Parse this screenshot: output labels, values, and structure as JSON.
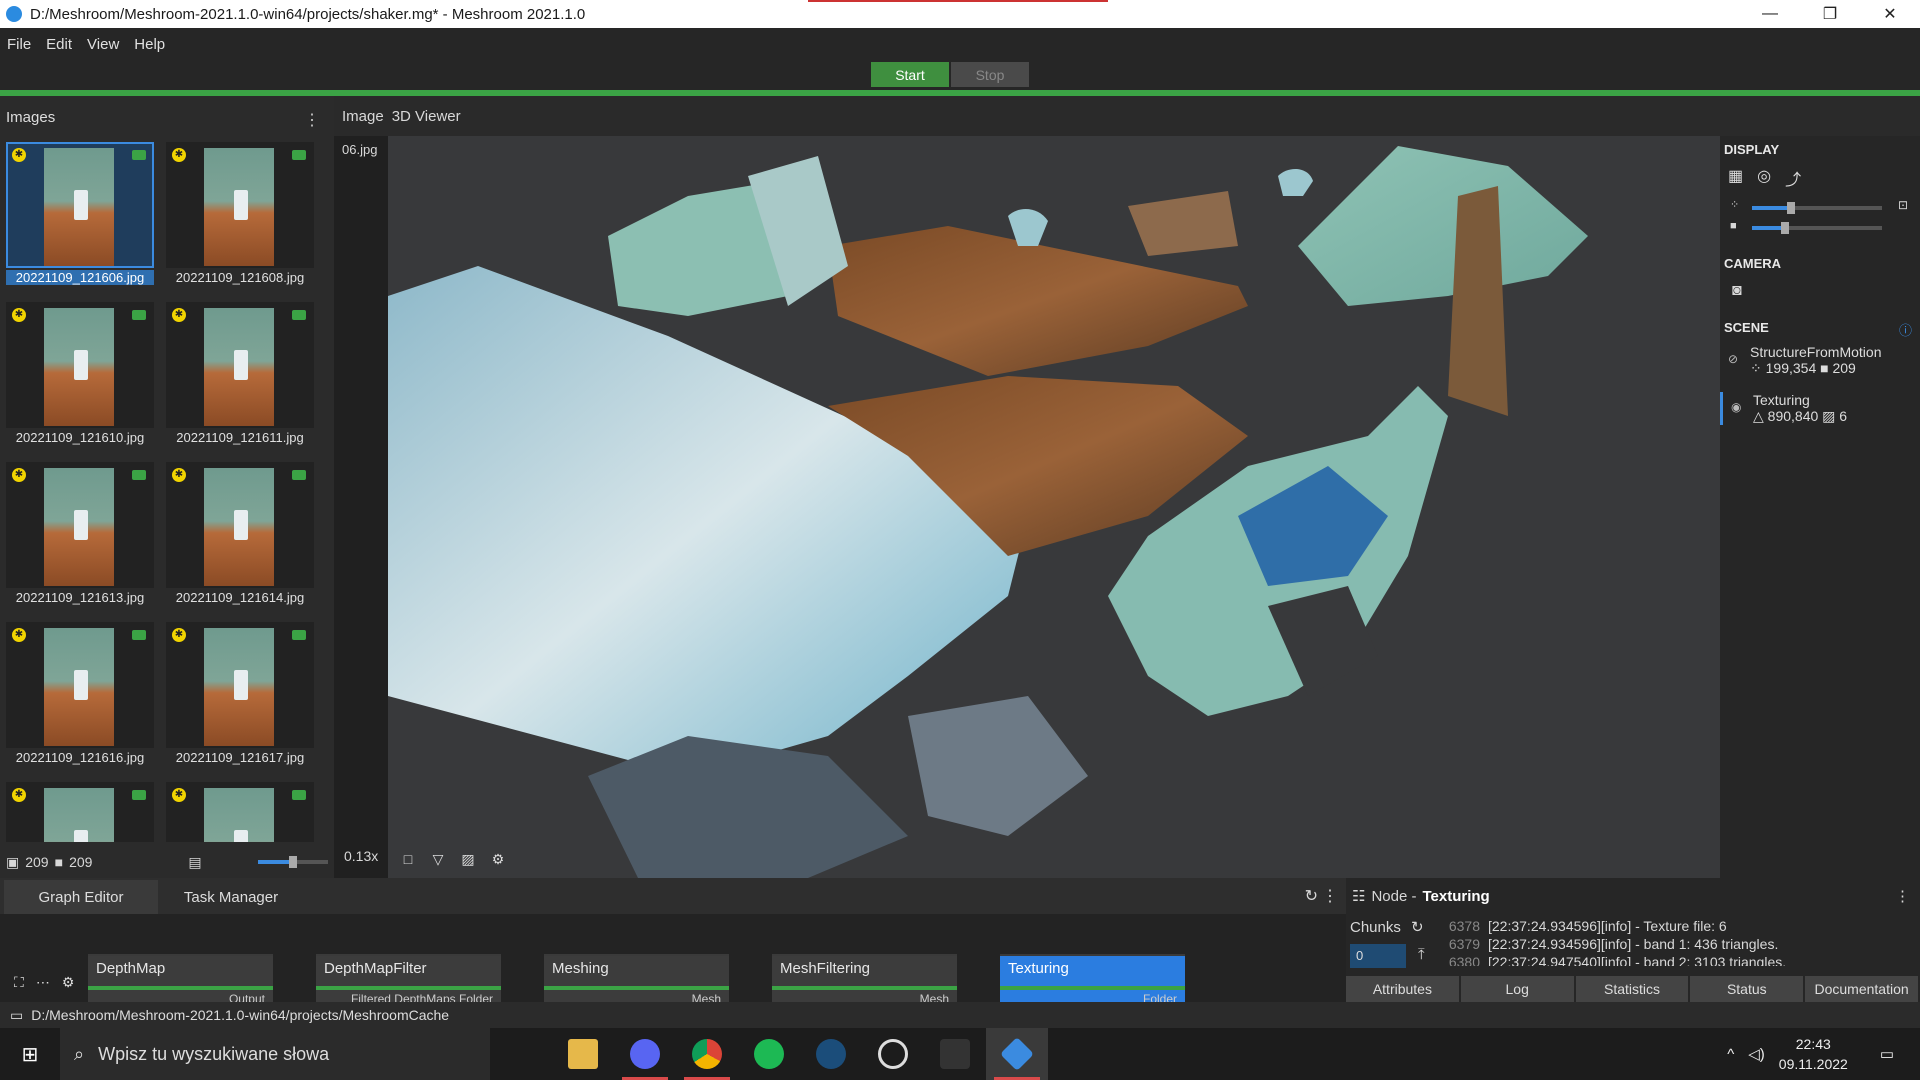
{
  "window": {
    "title": "D:/Meshroom/Meshroom-2021.1.0-win64/projects/shaker.mg* - Meshroom 2021.1.0",
    "minimize": "—",
    "maximize": "❐",
    "close": "✕"
  },
  "menu": [
    "File",
    "Edit",
    "View",
    "Help"
  ],
  "run": {
    "start": "Start",
    "stop": "Stop"
  },
  "images_panel": {
    "title": "Images",
    "kebab": "⋮",
    "thumbs": [
      {
        "name": "20221109_121606.jpg",
        "selected": true
      },
      {
        "name": "20221109_121608.jpg"
      },
      {
        "name": "20221109_121610.jpg"
      },
      {
        "name": "20221109_121611.jpg"
      },
      {
        "name": "20221109_121613.jpg"
      },
      {
        "name": "20221109_121614.jpg"
      },
      {
        "name": "20221109_121616.jpg"
      },
      {
        "name": "20221109_121617.jpg"
      },
      {
        "name": ""
      },
      {
        "name": ""
      }
    ],
    "image_count": "209",
    "camera_count": "209",
    "thumb_size_fraction": 0.5
  },
  "viewer": {
    "tabs": [
      "Image",
      "3D Viewer"
    ],
    "strip_filename": "06.jpg",
    "zoom": "0.13x"
  },
  "display": {
    "section": "DISPLAY",
    "point_size_fraction": 0.3,
    "camera_size_fraction": 0.25
  },
  "camera": {
    "section": "CAMERA"
  },
  "scene": {
    "section": "SCENE",
    "items": [
      {
        "name": "StructureFromMotion",
        "points": "199,354",
        "cameras": "209",
        "visible": false
      },
      {
        "name": "Texturing",
        "triangles": "890,840",
        "textures": "6",
        "visible": true
      }
    ]
  },
  "bottom": {
    "tabs": [
      "Graph Editor",
      "Task Manager"
    ],
    "nodes": [
      {
        "name": "DepthMap",
        "output": "Output"
      },
      {
        "name": "DepthMapFilter",
        "output": "Filtered DepthMaps Folder"
      },
      {
        "name": "Meshing",
        "output": "Mesh"
      },
      {
        "name": "MeshFiltering",
        "output": "Mesh"
      },
      {
        "name": "Texturing",
        "output": "Folder",
        "selected": true
      }
    ]
  },
  "node_panel": {
    "prefix": "Node - ",
    "node_name": "Texturing",
    "chunks_label": "Chunks",
    "chunk_value": "0",
    "log": [
      {
        "line": "6378",
        "text": "[22:37:24.934596][info]   - Texture file: 6"
      },
      {
        "line": "6379",
        "text": "[22:37:24.934596][info]     - band 1: 436 triangles."
      },
      {
        "line": "6380",
        "text": "[22:37:24.947540][info]     - band 2: 3103 triangles."
      }
    ],
    "tabs": [
      "Attributes",
      "Log",
      "Statistics",
      "Status",
      "Documentation"
    ]
  },
  "status": {
    "path": "D:/Meshroom/Meshroom-2021.1.0-win64/projects/MeshroomCache"
  },
  "taskbar": {
    "search_placeholder": "Wpisz tu wyszukiwane słowa",
    "time": "22:43",
    "date": "09.11.2022"
  },
  "colors": {
    "accent": "#3b8be0",
    "green": "#3ba345",
    "selected_node": "#2b7de0"
  }
}
